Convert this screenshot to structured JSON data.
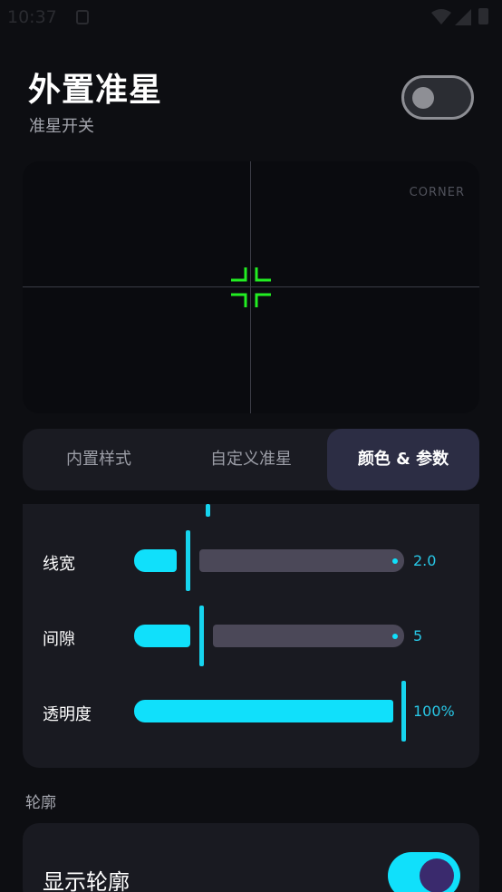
{
  "status_bar": {
    "time": "10:37"
  },
  "header": {
    "title": "外置准星",
    "subtitle": "准星开关",
    "master_toggle_on": false
  },
  "preview": {
    "corner_label": "CORNER",
    "crosshair_color": "#22ee22"
  },
  "tabs": [
    {
      "label": "内置样式",
      "active": false
    },
    {
      "label": "自定义准星",
      "active": false
    },
    {
      "label": "颜色 & 参数",
      "active": true
    }
  ],
  "params": [
    {
      "label": "线宽",
      "value": "2.0"
    },
    {
      "label": "间隙",
      "value": "5"
    },
    {
      "label": "透明度",
      "value": "100%"
    }
  ],
  "outline_section": {
    "heading": "轮廓",
    "show_outline_label": "显示轮廓",
    "show_outline_on": true
  },
  "colors": {
    "accent": "#10e0fb",
    "track": "#4b4858",
    "background": "#0d0e12",
    "card": "#191a21"
  }
}
